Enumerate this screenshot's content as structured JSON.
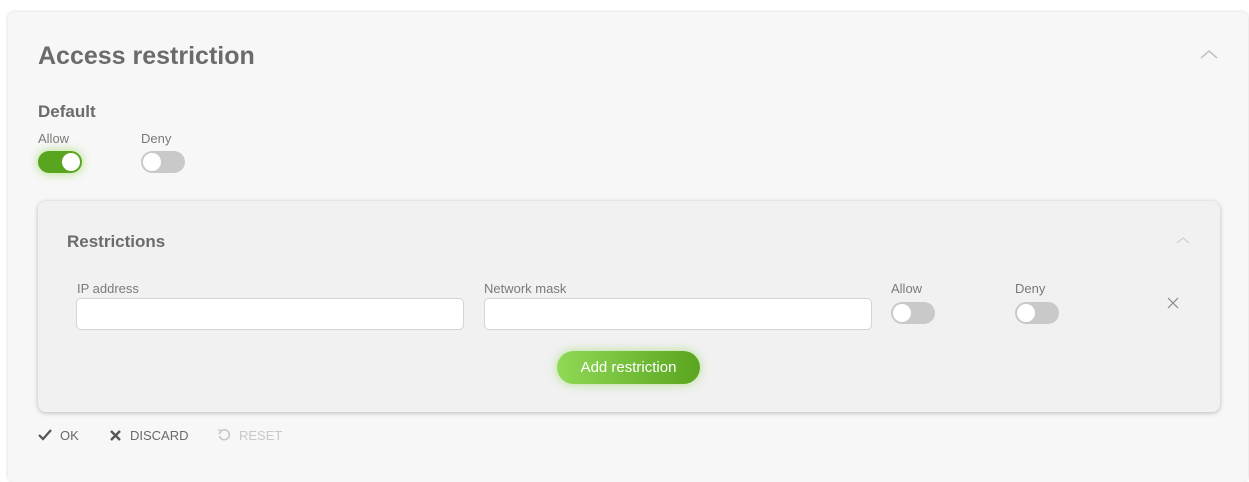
{
  "title": "Access restriction",
  "default": {
    "label": "Default",
    "allow_label": "Allow",
    "deny_label": "Deny",
    "allow_on": true,
    "deny_on": false
  },
  "restrictions": {
    "title": "Restrictions",
    "columns": {
      "ip": "IP address",
      "mask": "Network mask",
      "allow": "Allow",
      "deny": "Deny"
    },
    "rows": [
      {
        "ip": "",
        "mask": "",
        "allow_on": false,
        "deny_on": false
      }
    ],
    "add_label": "Add restriction"
  },
  "actions": {
    "ok": "OK",
    "discard": "DISCARD",
    "reset": "RESET"
  },
  "colors": {
    "accent": "#5aa51f",
    "accent_light": "#8fd957",
    "toggle_off": "#c9c9c9",
    "text": "#6b6b6b"
  },
  "icons": [
    "chevron-up-icon",
    "close-icon",
    "check-icon",
    "discard-icon",
    "reset-icon"
  ]
}
